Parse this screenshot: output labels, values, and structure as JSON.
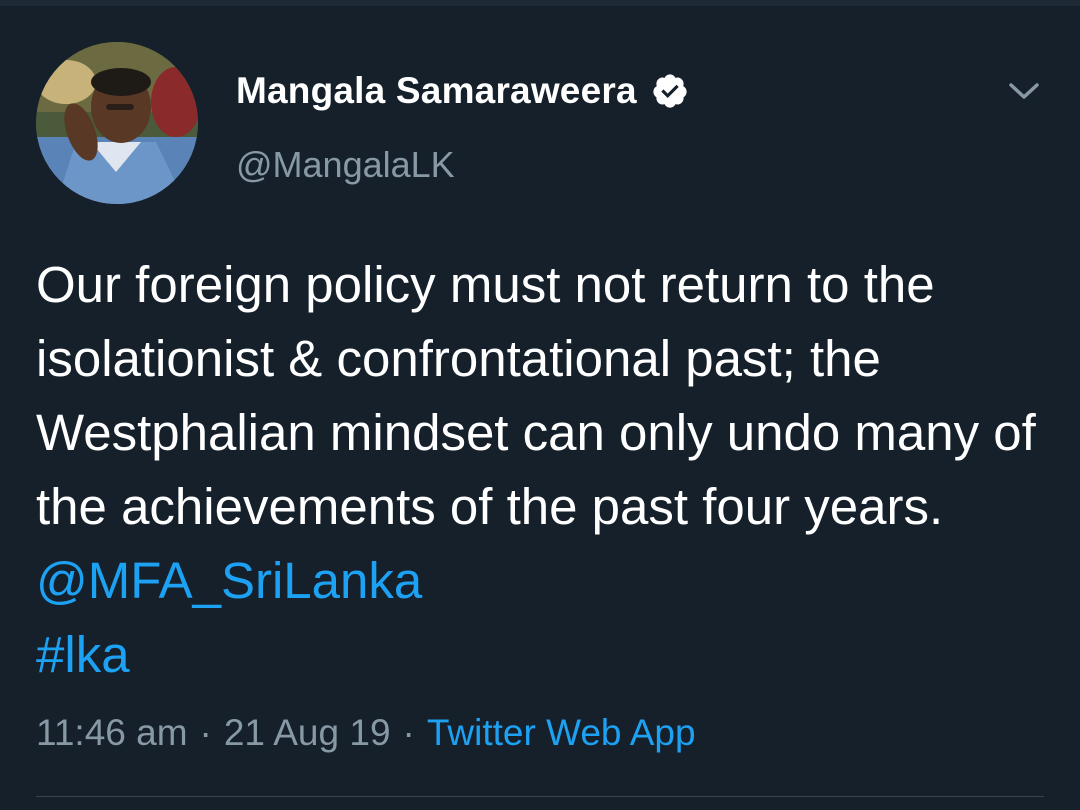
{
  "author": {
    "display_name": "Mangala Samaraweera",
    "handle": "@MangalaLK",
    "verified": true
  },
  "tweet": {
    "text_before_mention": "Our foreign policy must not return to the isolationist & confrontational past; the Westphalian mindset can only undo many of the achievements of the past four years. ",
    "mention": "@MFA_SriLanka",
    "hashtag": "#lka"
  },
  "meta": {
    "time": "11:46 am",
    "separator": "·",
    "date": "21 Aug 19",
    "source": "Twitter Web App"
  },
  "icons": {
    "verified": "verified-badge-icon",
    "menu": "chevron-down-icon"
  },
  "colors": {
    "background": "#15202b",
    "link": "#1da1f2",
    "secondary_text": "#8899a6"
  }
}
